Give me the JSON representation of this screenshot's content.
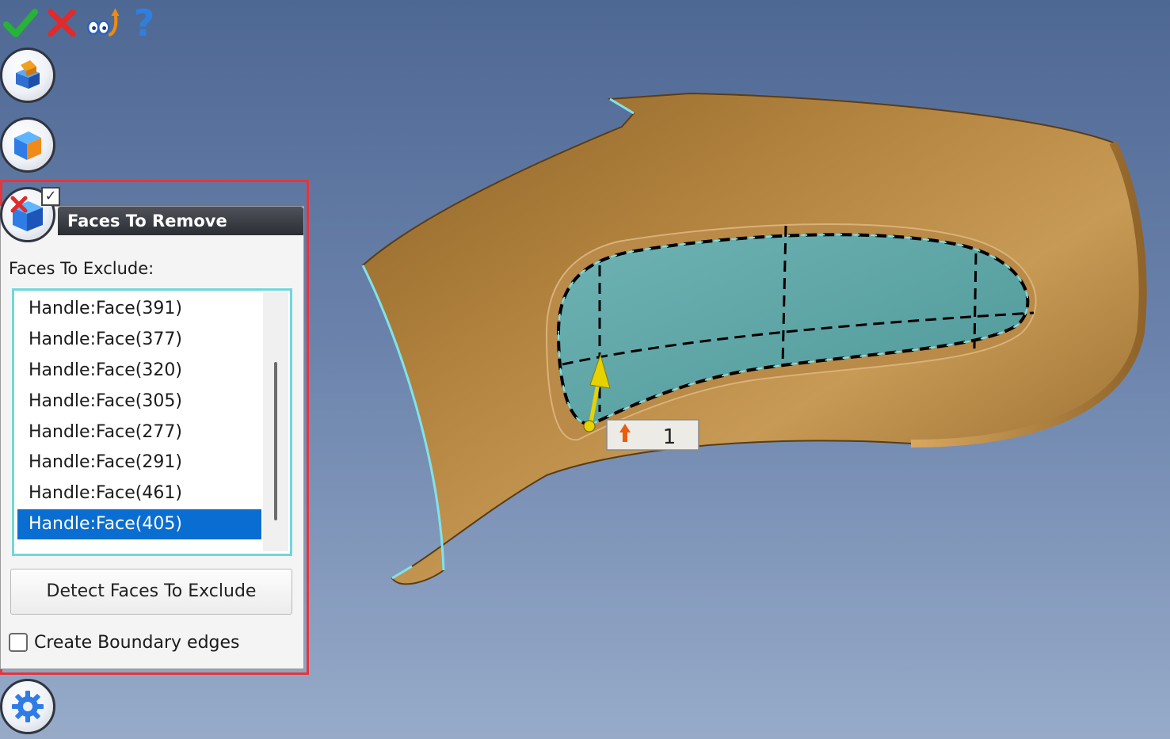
{
  "toolbar": {
    "accept_icon": "green-check-icon",
    "cancel_icon": "red-x-icon",
    "preview_icon": "preview-eyes-icon",
    "help_label": "?"
  },
  "side_buttons": [
    {
      "name": "part-tool-icon"
    },
    {
      "name": "box-solid-icon"
    },
    {
      "name": "remove-faces-icon"
    },
    {
      "name": "settings-gear-icon"
    }
  ],
  "panel": {
    "title": "Faces To Remove",
    "faces_to_exclude_label": "Faces To Exclude:",
    "faces": [
      {
        "label": "Handle:Face(391)",
        "selected": false
      },
      {
        "label": "Handle:Face(377)",
        "selected": false
      },
      {
        "label": "Handle:Face(320)",
        "selected": false
      },
      {
        "label": "Handle:Face(305)",
        "selected": false
      },
      {
        "label": "Handle:Face(277)",
        "selected": false
      },
      {
        "label": "Handle:Face(291)",
        "selected": false
      },
      {
        "label": "Handle:Face(461)",
        "selected": false
      },
      {
        "label": "Handle:Face(405)",
        "selected": true
      }
    ],
    "detect_button_label": "Detect Faces To Exclude",
    "create_boundary_label": "Create Boundary edges",
    "create_boundary_checked": false
  },
  "viewport": {
    "tag_number": "1",
    "colors": {
      "background_top": "#4e6894",
      "background_bottom": "#97abc9",
      "part_surface": "#a77a3c",
      "selected_face": "#5aa4a6",
      "highlight_edge": "#7fe3ea",
      "accent": "#e3363d",
      "selection": "#0a6dd1"
    }
  }
}
